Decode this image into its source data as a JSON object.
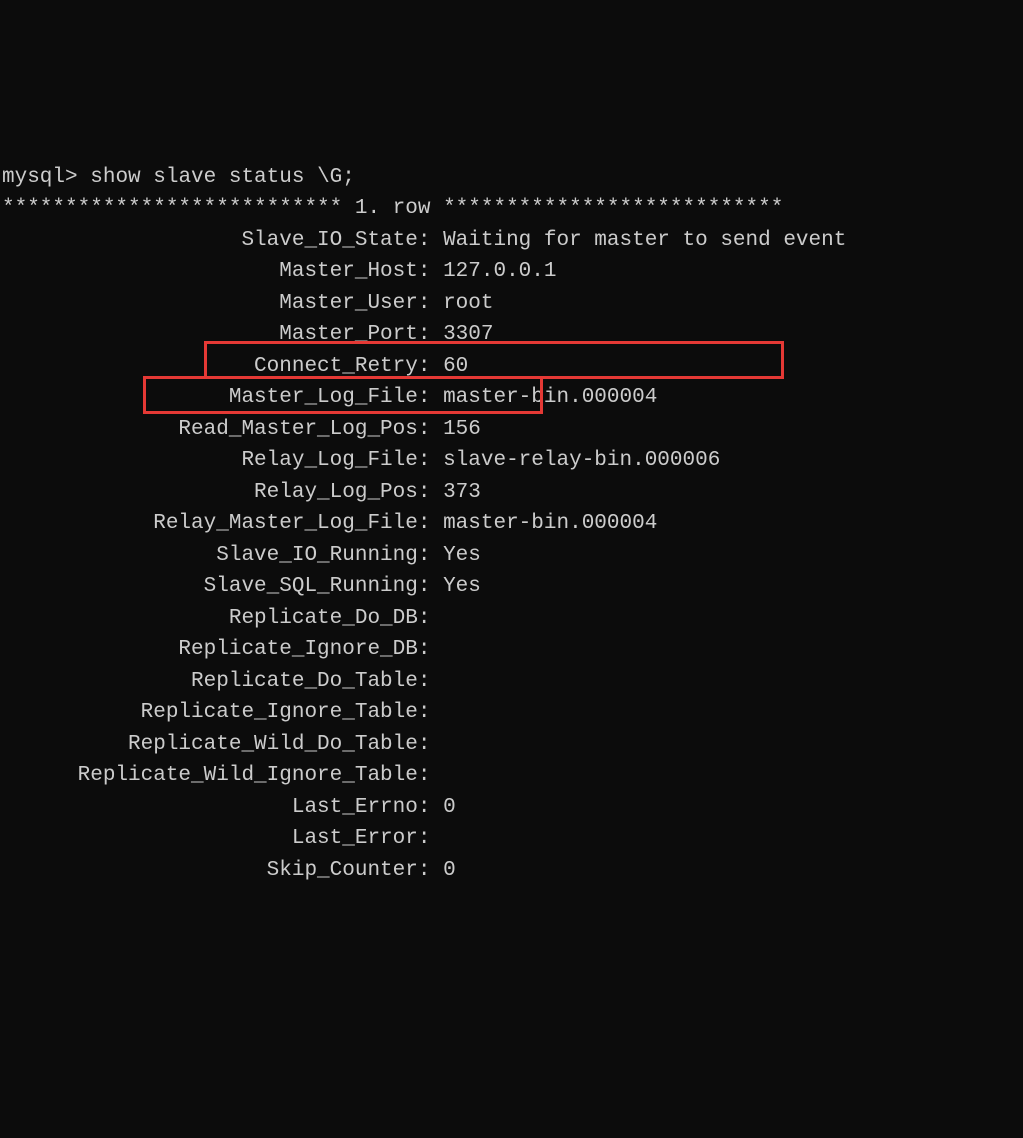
{
  "prompt": "mysql>",
  "command": "show slave status \\G;",
  "row_header": "*************************** 1. row ***************************",
  "fields": [
    {
      "k": "Slave_IO_State",
      "v": "Waiting for master to send event"
    },
    {
      "k": "Master_Host",
      "v": "127.0.0.1"
    },
    {
      "k": "Master_User",
      "v": "root"
    },
    {
      "k": "Master_Port",
      "v": "3307"
    },
    {
      "k": "Connect_Retry",
      "v": "60"
    },
    {
      "k": "Master_Log_File",
      "v": "master-bin.000004"
    },
    {
      "k": "Read_Master_Log_Pos",
      "v": "156"
    },
    {
      "k": "Relay_Log_File",
      "v": "slave-relay-bin.000006"
    },
    {
      "k": "Relay_Log_Pos",
      "v": "373"
    },
    {
      "k": "Relay_Master_Log_File",
      "v": "master-bin.000004"
    },
    {
      "k": "Slave_IO_Running",
      "v": "Yes"
    },
    {
      "k": "Slave_SQL_Running",
      "v": "Yes"
    },
    {
      "k": "Replicate_Do_DB",
      "v": ""
    },
    {
      "k": "Replicate_Ignore_DB",
      "v": ""
    },
    {
      "k": "Replicate_Do_Table",
      "v": ""
    },
    {
      "k": "Replicate_Ignore_Table",
      "v": ""
    },
    {
      "k": "Replicate_Wild_Do_Table",
      "v": ""
    },
    {
      "k": "Replicate_Wild_Ignore_Table",
      "v": ""
    },
    {
      "k": "Last_Errno",
      "v": "0"
    },
    {
      "k": "Last_Error",
      "v": ""
    },
    {
      "k": "Skip_Counter",
      "v": "0"
    }
  ],
  "highlighted_indices": [
    5,
    6
  ]
}
